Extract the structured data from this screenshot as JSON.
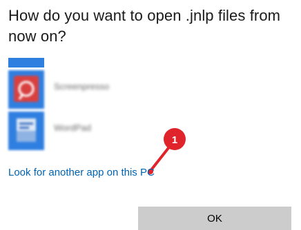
{
  "dialog": {
    "title": "How do you want to open .jnlp files from now on?"
  },
  "apps": [
    {
      "name": "Screenpresso",
      "icon": "screenpresso-app-icon",
      "color": "#d84040"
    },
    {
      "name": "WordPad",
      "icon": "wordpad-app-icon",
      "color": "#2f7fe0"
    }
  ],
  "link": {
    "label": "Look for another app on this PC",
    "color": "#0063b1"
  },
  "annotation": {
    "number": "1",
    "color": "#e0242b"
  },
  "ok_button": {
    "label": "OK"
  }
}
